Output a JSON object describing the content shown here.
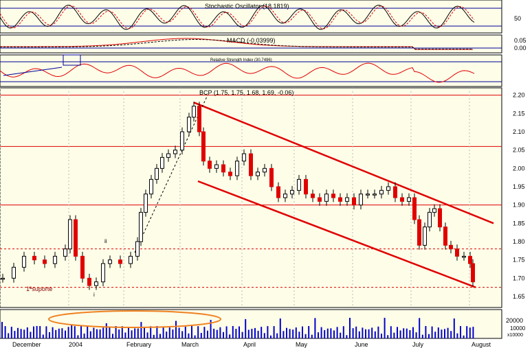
{
  "chart_data": {
    "type": "candlestick",
    "x_labels": [
      "December",
      "2004",
      "February",
      "March",
      "April",
      "May",
      "June",
      "July",
      "August"
    ],
    "price": {
      "y_ticks": [
        "2.20",
        "2.15",
        "2.10",
        "2.05",
        "2.00",
        "1.95",
        "1.90",
        "1.85",
        "1.80",
        "1.75",
        "1.70",
        "1.65"
      ],
      "ylim": [
        1.62,
        2.22
      ],
      "bcp_label": "BCP (1.75, 1.75, 1.68, 1.69, -0.06)",
      "annotations": [
        "1ªsuporte",
        "ii",
        "i"
      ],
      "horizontal_lines": [
        2.2,
        2.06,
        1.9
      ],
      "dashed_lines": [
        1.78,
        1.675
      ],
      "channel_upper": [
        [
          0,
          2.18
        ],
        [
          1,
          1.85
        ]
      ],
      "channel_lower": [
        [
          0,
          1.965
        ],
        [
          1,
          1.675
        ]
      ],
      "ohlc_sample": [
        {
          "month": "Dec",
          "close": 1.7
        },
        {
          "month": "Dec",
          "close": 1.76
        },
        {
          "month": "Dec",
          "close": 1.86
        },
        {
          "month": "Jan",
          "close": 1.7
        },
        {
          "month": "Jan",
          "close": 1.75
        },
        {
          "month": "Feb",
          "close": 1.9
        },
        {
          "month": "Feb",
          "close": 2.04
        },
        {
          "month": "Mar",
          "close": 2.17
        },
        {
          "month": "Mar",
          "close": 2.0
        },
        {
          "month": "Apr",
          "close": 2.02
        },
        {
          "month": "Apr",
          "close": 1.93
        },
        {
          "month": "May",
          "close": 1.91
        },
        {
          "month": "May",
          "close": 1.9
        },
        {
          "month": "Jun",
          "close": 1.93
        },
        {
          "month": "Jun",
          "close": 1.9
        },
        {
          "month": "Jul",
          "close": 1.78
        },
        {
          "month": "Jul",
          "close": 1.88
        },
        {
          "month": "Aug",
          "close": 1.69
        }
      ]
    },
    "indicators": {
      "stochastic": {
        "label": "Stochastic Oscillator (18.1819)",
        "tick": "50"
      },
      "macd": {
        "label": "MACD (-0.03999)",
        "ticks": [
          "0.05",
          "0.00"
        ]
      },
      "rsi": {
        "label": "Relative Strength Index (30.7496)"
      }
    },
    "volume": {
      "ticks": [
        "20000",
        "10000"
      ],
      "tick_small": "x10000"
    },
    "colors": {
      "up": "#ffffff",
      "down": "#e00000",
      "border": "#000000",
      "grid_red": "#e00000",
      "panel_bg": "#fdfde8",
      "volume": "#0000cc",
      "ellipse": "#f08020",
      "axis_bg": "#ffffff"
    }
  }
}
